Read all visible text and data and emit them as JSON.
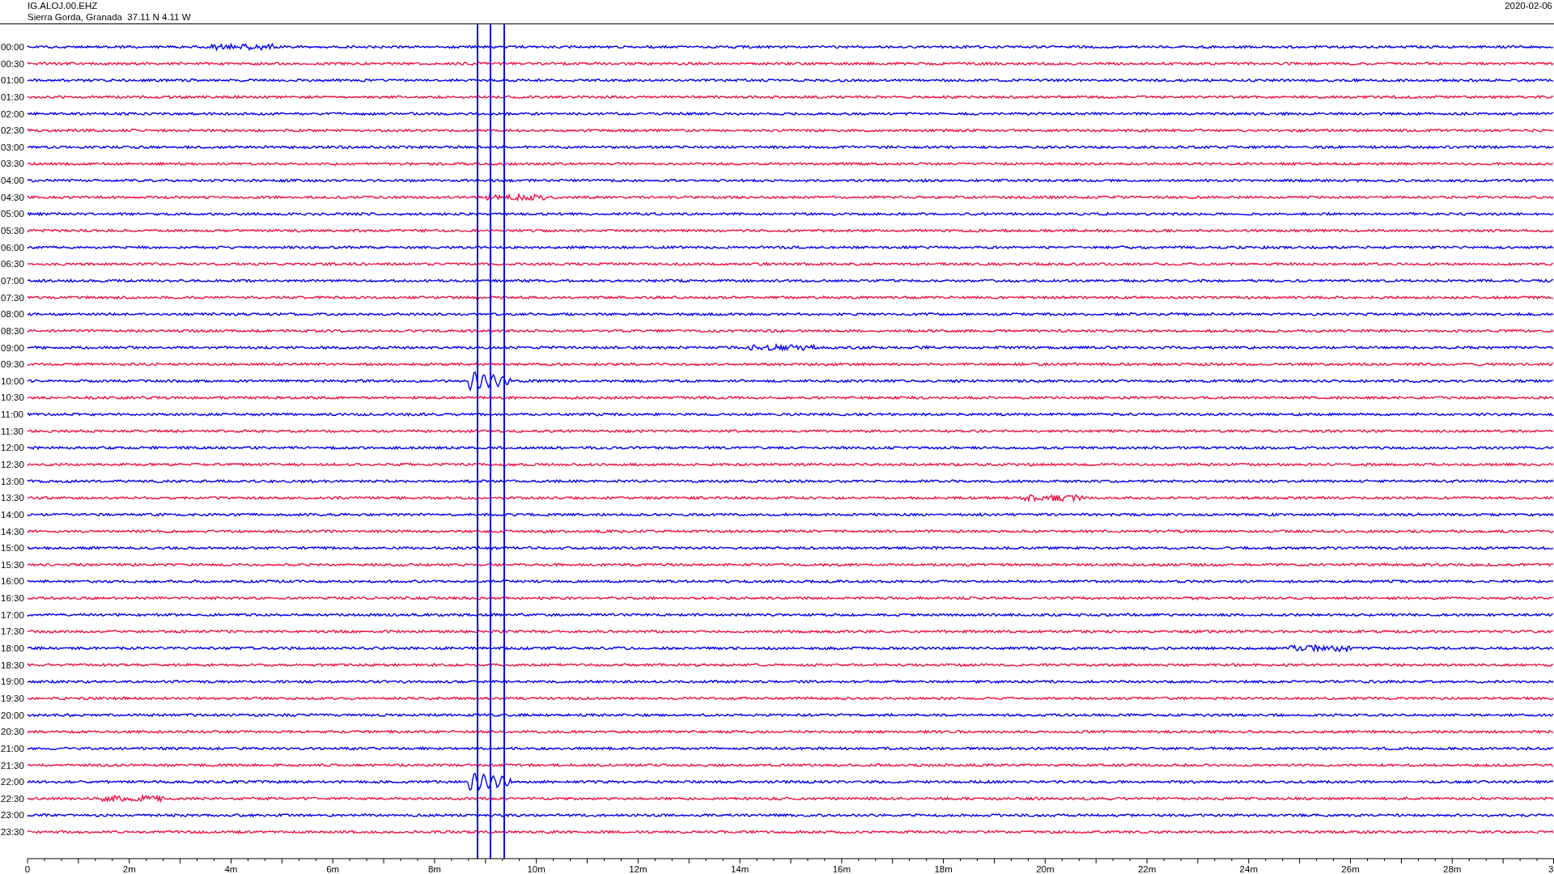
{
  "station": {
    "code": "IG.ALOJ.00.EHZ",
    "location": "Sierra Gorda, Granada  37.11 N 4.11 W",
    "date": "2020-02-06"
  },
  "rows": [
    {
      "time": "00:00",
      "color": "#0000ee"
    },
    {
      "time": "00:30",
      "color": "#ee1144"
    },
    {
      "time": "01:00",
      "color": "#0000ee"
    },
    {
      "time": "01:30",
      "color": "#ee1144"
    },
    {
      "time": "02:00",
      "color": "#0000ee"
    },
    {
      "time": "02:30",
      "color": "#ee1144"
    },
    {
      "time": "03:00",
      "color": "#0000ee"
    },
    {
      "time": "03:30",
      "color": "#ee1144"
    },
    {
      "time": "04:00",
      "color": "#0000ee"
    },
    {
      "time": "04:30",
      "color": "#ee1144"
    },
    {
      "time": "05:00",
      "color": "#0000ee"
    },
    {
      "time": "05:30",
      "color": "#ee1144"
    },
    {
      "time": "06:00",
      "color": "#0000ee"
    },
    {
      "time": "06:30",
      "color": "#ee1144"
    },
    {
      "time": "07:00",
      "color": "#0000ee"
    },
    {
      "time": "07:30",
      "color": "#ee1144"
    },
    {
      "time": "08:00",
      "color": "#0000ee"
    },
    {
      "time": "08:30",
      "color": "#ee1144"
    },
    {
      "time": "09:00",
      "color": "#0000ee"
    },
    {
      "time": "09:30",
      "color": "#ee1144"
    },
    {
      "time": "10:00",
      "color": "#0000ee"
    },
    {
      "time": "10:30",
      "color": "#ee1144"
    },
    {
      "time": "11:00",
      "color": "#0000ee"
    },
    {
      "time": "11:30",
      "color": "#ee1144"
    },
    {
      "time": "12:00",
      "color": "#0000ee"
    },
    {
      "time": "12:30",
      "color": "#ee1144"
    },
    {
      "time": "13:00",
      "color": "#0000ee"
    },
    {
      "time": "13:30",
      "color": "#ee1144"
    },
    {
      "time": "14:00",
      "color": "#0000ee"
    },
    {
      "time": "14:30",
      "color": "#ee1144"
    },
    {
      "time": "15:00",
      "color": "#0000ee"
    },
    {
      "time": "15:30",
      "color": "#ee1144"
    },
    {
      "time": "16:00",
      "color": "#0000ee"
    },
    {
      "time": "16:30",
      "color": "#ee1144"
    },
    {
      "time": "17:00",
      "color": "#0000ee"
    },
    {
      "time": "17:30",
      "color": "#ee1144"
    },
    {
      "time": "18:00",
      "color": "#0000ee"
    },
    {
      "time": "18:30",
      "color": "#ee1144"
    },
    {
      "time": "19:00",
      "color": "#0000ee"
    },
    {
      "time": "19:30",
      "color": "#ee1144"
    },
    {
      "time": "20:00",
      "color": "#0000ee"
    },
    {
      "time": "20:30",
      "color": "#ee1144"
    },
    {
      "time": "21:00",
      "color": "#0000ee"
    },
    {
      "time": "21:30",
      "color": "#ee1144"
    },
    {
      "time": "22:00",
      "color": "#0000ee"
    },
    {
      "time": "22:30",
      "color": "#ee1144"
    },
    {
      "time": "23:00",
      "color": "#0000ee"
    },
    {
      "time": "23:30",
      "color": "#ee1144"
    }
  ],
  "x_axis": {
    "ticks": [
      "0",
      "2m",
      "4m",
      "6m",
      "8m",
      "10m",
      "12m",
      "14m",
      "16m",
      "18m",
      "20m",
      "22m",
      "24m",
      "26m",
      "28m",
      "3"
    ]
  }
}
